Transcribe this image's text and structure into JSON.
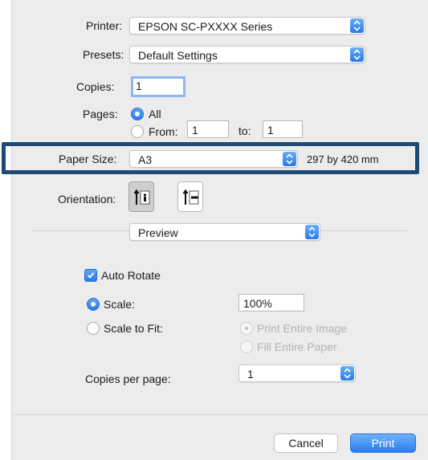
{
  "printer": {
    "label": "Printer:",
    "value": "EPSON SC-PXXXX Series"
  },
  "presets": {
    "label": "Presets:",
    "value": "Default Settings"
  },
  "copies": {
    "label": "Copies:",
    "value": "1"
  },
  "pages": {
    "label": "Pages:",
    "all_label": "All",
    "from_label": "From:",
    "from_value": "1",
    "to_label": "to:",
    "to_value": "1",
    "selected": "All"
  },
  "paper_size": {
    "label": "Paper Size:",
    "value": "A3",
    "dimensions": "297 by 420 mm"
  },
  "orientation": {
    "label": "Orientation:",
    "options": [
      "portrait-icon",
      "landscape-icon"
    ],
    "selected": "portrait"
  },
  "section": {
    "value": "Preview"
  },
  "preview": {
    "auto_rotate_label": "Auto Rotate",
    "auto_rotate_checked": true,
    "scale_label": "Scale:",
    "scale_value": "100%",
    "scale_to_fit_label": "Scale to Fit:",
    "print_entire_image_label": "Print Entire Image",
    "fill_entire_paper_label": "Fill Entire Paper",
    "copies_per_page_label": "Copies per page:",
    "copies_per_page_value": "1"
  },
  "buttons": {
    "cancel": "Cancel",
    "print": "Print"
  },
  "colors": {
    "accent": "#2a7cf0",
    "highlight_border": "#1f4a76",
    "background": "#ececec"
  }
}
